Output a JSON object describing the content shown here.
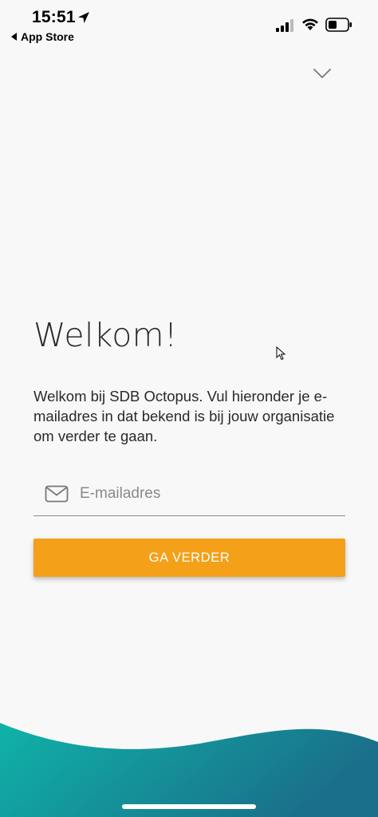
{
  "status_bar": {
    "time": "15:51",
    "back_app": "App Store",
    "icons": [
      "location-arrow-icon",
      "cellular-signal-icon",
      "wifi-icon",
      "battery-icon"
    ]
  },
  "header": {
    "collapse_icon": "chevron-down-icon"
  },
  "main": {
    "title": "Welkom!",
    "description": "Welkom bij SDB Octopus. Vul hieronder je e-mailadres in dat bekend is bij jouw organisatie om verder te gaan.",
    "email": {
      "placeholder": "E-mailadres",
      "value": "",
      "icon": "mail-icon"
    },
    "continue_label": "GA VERDER"
  },
  "colors": {
    "background": "#f8f8f8",
    "accent": "#f4a018",
    "wave_start": "#0fb3a8",
    "wave_end": "#1a6f8a"
  }
}
